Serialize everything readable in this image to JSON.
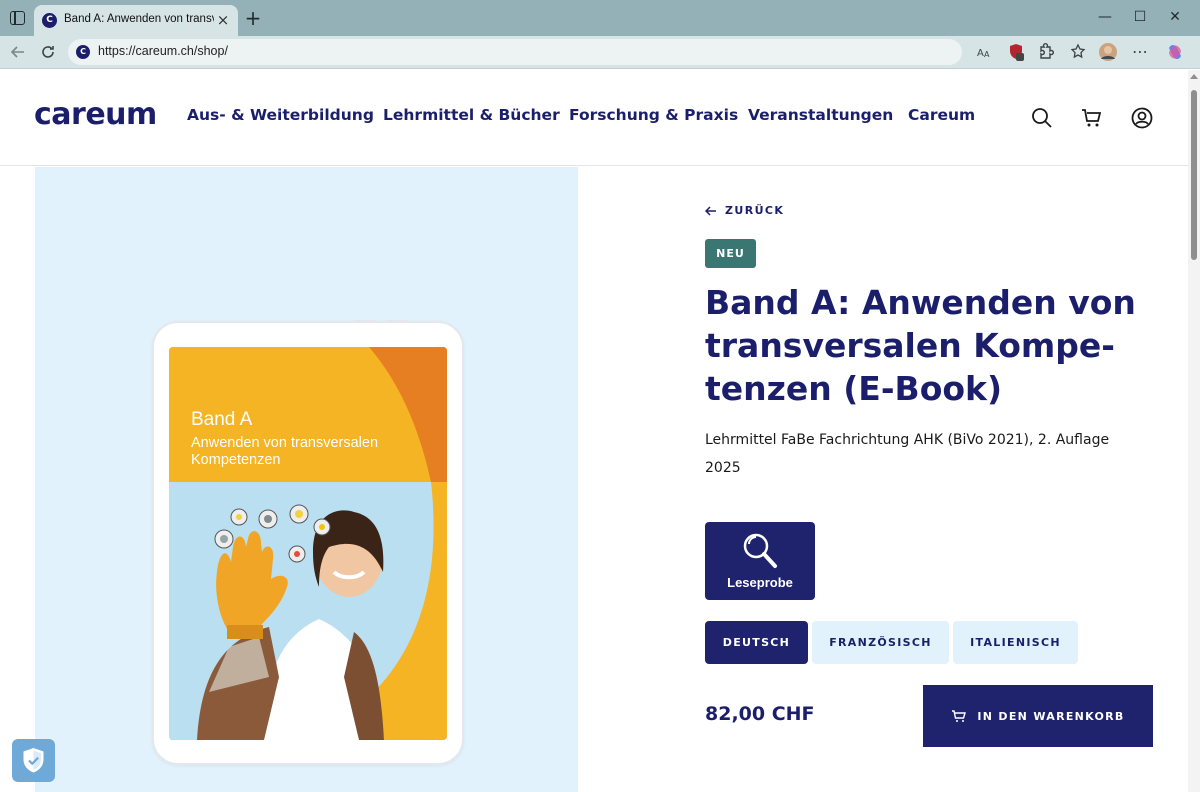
{
  "browser": {
    "tab_title": "Band A: Anwenden von transversa",
    "url": "https://careum.ch/shop/"
  },
  "site": {
    "logo": "careum",
    "nav": [
      {
        "label": "Aus- & Weiterbildung"
      },
      {
        "label": "Lehrmittel & Bücher"
      },
      {
        "label": "Forschung & Praxis"
      },
      {
        "label": "Veranstaltungen"
      },
      {
        "label": "Careum"
      }
    ]
  },
  "cover": {
    "band": "Band A",
    "subtitle": "Anwenden von transversalen Kompetenzen"
  },
  "product": {
    "back_label": "ZURÜCK",
    "badge": "NEU",
    "title": "Band A: Anwenden von transversalen Kompe-tenzen (E-Book)",
    "subtitle": "Lehrmittel FaBe Fachrichtung AHK (BiVo 2021), 2. Auflage 2025",
    "leseprobe_label": "Leseprobe",
    "languages": [
      {
        "label": "DEUTSCH",
        "selected": true
      },
      {
        "label": "FRANZÖSISCH",
        "selected": false
      },
      {
        "label": "ITALIENISCH",
        "selected": false
      }
    ],
    "price": "82,00 CHF",
    "cart_label": "IN DEN WARENKORB"
  },
  "colors": {
    "brand_navy": "#1b1f6b",
    "badge_teal": "#3a7773",
    "hero_bg": "#e2f2fc",
    "cover_yellow": "#f4b423",
    "cover_orange": "#e67e22"
  },
  "icons": {
    "search": "search-icon",
    "cart": "cart-icon",
    "account": "account-icon",
    "back": "arrow-left-icon",
    "leseprobe": "magnifier-icon"
  }
}
